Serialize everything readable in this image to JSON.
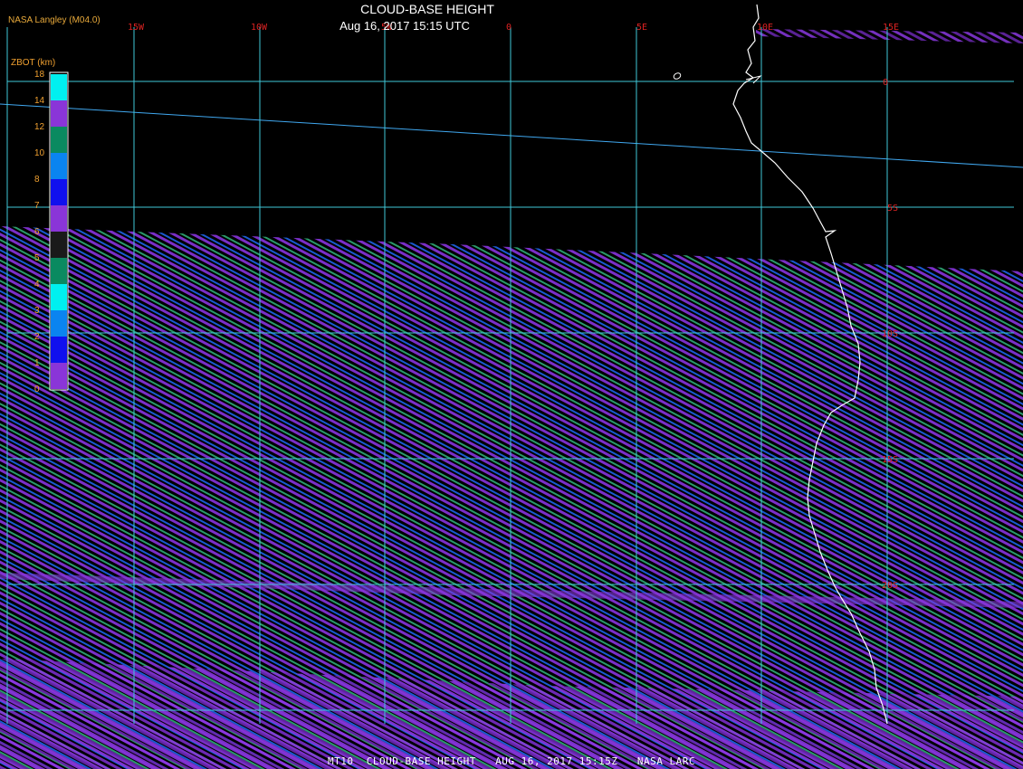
{
  "header": {
    "title": "CLOUD-BASE HEIGHT",
    "datetime": "Aug 16, 2017 15:15 UTC",
    "producer": "NASA Langley (M04.0)"
  },
  "footer": {
    "text": "MT10  CLOUD-BASE HEIGHT   AUG 16, 2017 15:15Z   NASA LARC"
  },
  "colorbar": {
    "title": "ZBOT (km)",
    "ticks": [
      "0",
      "1",
      "2",
      "3",
      "4",
      "5",
      "6",
      "7",
      "8",
      "10",
      "12",
      "14",
      "18"
    ],
    "colors": [
      "#8a35d8",
      "#1010ee",
      "#0a84f0",
      "#00f0f0",
      "#0a8a60",
      "#1a1a1a",
      "#8a35d8",
      "#1010ee",
      "#0a84f0",
      "#0a8a60",
      "#8a35d8",
      "#00f0f0"
    ]
  },
  "grid": {
    "lon_labels": [
      "15W",
      "10W",
      "5W",
      "0",
      "5E",
      "10E",
      "15E"
    ],
    "lat_labels": [
      "0",
      "5S",
      "10S",
      "15S",
      "20S"
    ],
    "grid_color": "#40c8d8",
    "coast_color": "#ffffff"
  }
}
